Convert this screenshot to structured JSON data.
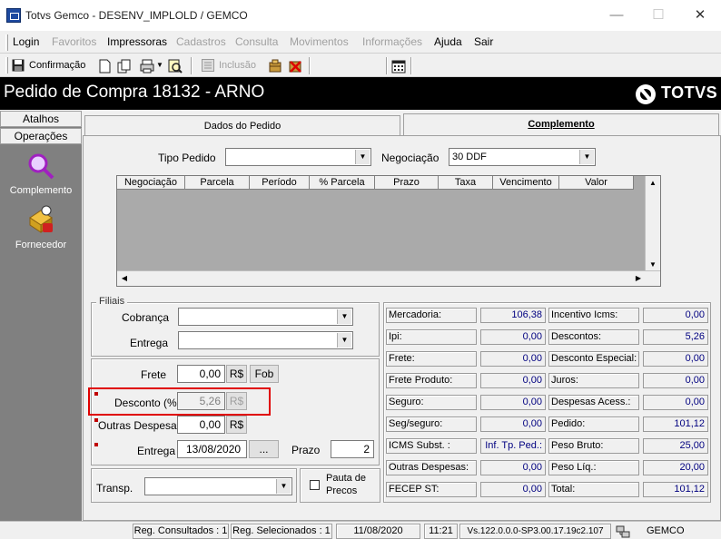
{
  "window": {
    "title": "Totvs Gemco - DESENV_IMPLOLD / GEMCO",
    "controls": {
      "minimize": "—",
      "maximize": "☐",
      "close": "✕"
    }
  },
  "menubar": {
    "items": [
      {
        "label": "Login",
        "enabled": true
      },
      {
        "label": "Favoritos",
        "enabled": false
      },
      {
        "label": "Impressoras",
        "enabled": true
      },
      {
        "label": "Cadastros",
        "enabled": false
      },
      {
        "label": "Consulta",
        "enabled": false
      },
      {
        "label": "Movimentos",
        "enabled": false
      },
      {
        "label": "Informações",
        "enabled": false
      },
      {
        "label": "Ajuda",
        "enabled": true
      },
      {
        "label": "Sair",
        "enabled": true
      }
    ]
  },
  "toolbar": {
    "confirm_label": "Confirmação",
    "insert_label": "Inclusão"
  },
  "header": {
    "title": "Pedido de Compra  18132 - ARNO",
    "logo": "TOTVS"
  },
  "left_panel": {
    "tabs": [
      "Atalhos",
      "Operações"
    ],
    "items": [
      {
        "label": "Complemento",
        "icon": "magnifier-icon"
      },
      {
        "label": "Fornecedor",
        "icon": "supplier-icon"
      }
    ]
  },
  "tabs": [
    {
      "label": "Dados do Pedido",
      "active": false
    },
    {
      "label": "Complemento",
      "active": true
    }
  ],
  "form": {
    "tipo_pedido_label": "Tipo Pedido",
    "tipo_pedido_value": "",
    "negociacao_label": "Negociação",
    "negociacao_value": "30 DDF",
    "grid_columns": [
      "Negociação",
      "Parcela",
      "Período",
      "% Parcela",
      "Prazo",
      "Taxa",
      "Vencimento",
      "Valor"
    ],
    "filiais_title": "Filiais",
    "cobranca_label": "Cobrança",
    "cobranca_value": "",
    "entrega_label": "Entrega",
    "entrega_value": "",
    "frete_label": "Frete",
    "frete_value": "0,00",
    "currency_btn": "R$",
    "fob_btn": "Fob",
    "desconto_label": "Desconto (%)",
    "desconto_value": "5,26",
    "outras_label": "Outras Despesas:",
    "outras_value": "0,00",
    "entrega_data_label": "Entrega",
    "entrega_data_value": "13/08/2020",
    "ellipsis_btn": "...",
    "prazo_label": "Prazo",
    "prazo_value": "2",
    "transp_label": "Transp.",
    "transp_value": "",
    "pauta_label_1": "Pauta de",
    "pauta_label_2": "Precos",
    "highlight_color": "#e00000"
  },
  "totals": {
    "left": [
      {
        "label": "Mercadoria:",
        "value": "106,38"
      },
      {
        "label": "Ipi:",
        "value": "0,00"
      },
      {
        "label": "Frete:",
        "value": "0,00"
      },
      {
        "label": "Frete Produto:",
        "value": "0,00"
      },
      {
        "label": "Seguro:",
        "value": "0,00"
      },
      {
        "label": "Seg/seguro:",
        "value": "0,00"
      },
      {
        "label": "ICMS Subst. :",
        "value": "Inf. Tp. Ped.:"
      },
      {
        "label": "Outras Despesas:",
        "value": "0,00"
      },
      {
        "label": "FECEP ST:",
        "value": "0,00"
      }
    ],
    "right": [
      {
        "label": "Incentivo Icms:",
        "value": "0,00"
      },
      {
        "label": "Descontos:",
        "value": "5,26"
      },
      {
        "label": "Desconto Especial:",
        "value": "0,00"
      },
      {
        "label": "Juros:",
        "value": "0,00"
      },
      {
        "label": "Despesas Acess.:",
        "value": "0,00"
      },
      {
        "label": "Pedido:",
        "value": "101,12"
      },
      {
        "label": "Peso Bruto:",
        "value": "25,00"
      },
      {
        "label": "Peso Líq.:",
        "value": "20,00"
      },
      {
        "label": "Total:",
        "value": "101,12"
      }
    ]
  },
  "statusbar": {
    "consultados": "Reg. Consultados : 1",
    "selecionados": "Reg. Selecionados : 1",
    "date": "11/08/2020",
    "time": "11:21",
    "version": "Vs.122.0.0.0-SP3.00.17.19c2.107",
    "env": "GEMCO"
  }
}
